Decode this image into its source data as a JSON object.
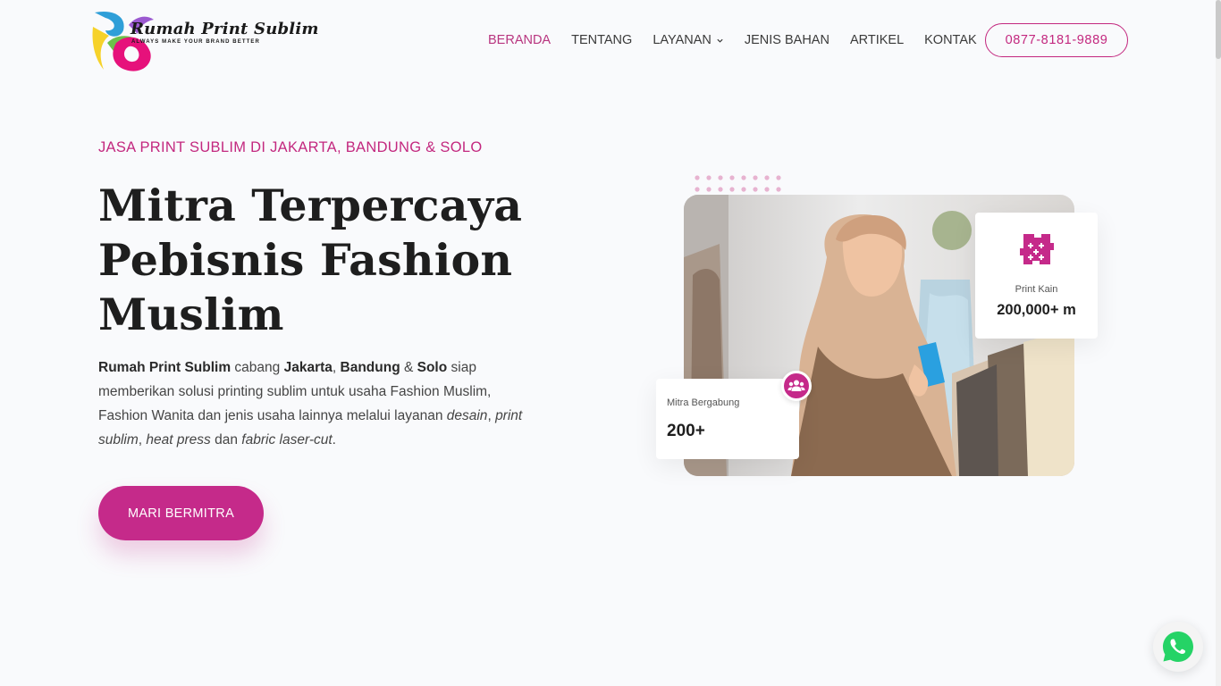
{
  "brand": {
    "name": "Rumah Print Sublim",
    "tagline": "ALWAYS MAKE YOUR BRAND BETTER",
    "accent": "#c52a8a"
  },
  "nav": {
    "items": [
      {
        "label": "BERANDA",
        "active": true
      },
      {
        "label": "TENTANG"
      },
      {
        "label": "LAYANAN",
        "has_dropdown": true
      },
      {
        "label": "JENIS BAHAN"
      },
      {
        "label": "ARTIKEL"
      },
      {
        "label": "KONTAK"
      }
    ],
    "phone": "0877-8181-9889"
  },
  "hero": {
    "kicker": "JASA PRINT SUBLIM DI JAKARTA, BANDUNG & SOLO",
    "title_lines": [
      "Mitra Terpercaya",
      "Pebisnis Fashion",
      "Muslim"
    ],
    "desc": {
      "p1": "Rumah Print Sublim",
      "p2": " cabang ",
      "p3": "Jakarta",
      "p4": ", ",
      "p5": "Bandung",
      "p6": " & ",
      "p7": "Solo",
      "p8": " siap memberikan solusi printing sublim untuk usaha Fashion Muslim, Fashion Wanita dan jenis usaha lainnya melalui layanan ",
      "p9": "desain",
      "p10": ", ",
      "p11": "print sublim",
      "p12": ", ",
      "p13": "heat press",
      "p14": " dan ",
      "p15": "fabric laser-cut",
      "p16": "."
    },
    "cta": "MARI BERMITRA"
  },
  "stats": {
    "kain": {
      "label": "Print Kain",
      "value": "200,000+ m",
      "icon": "fabric-print-icon"
    },
    "mitra": {
      "label": "Mitra Bergabung",
      "value": "200+",
      "icon": "users-icon"
    }
  },
  "floating": {
    "icon": "whatsapp-icon",
    "color": "#25d366"
  }
}
